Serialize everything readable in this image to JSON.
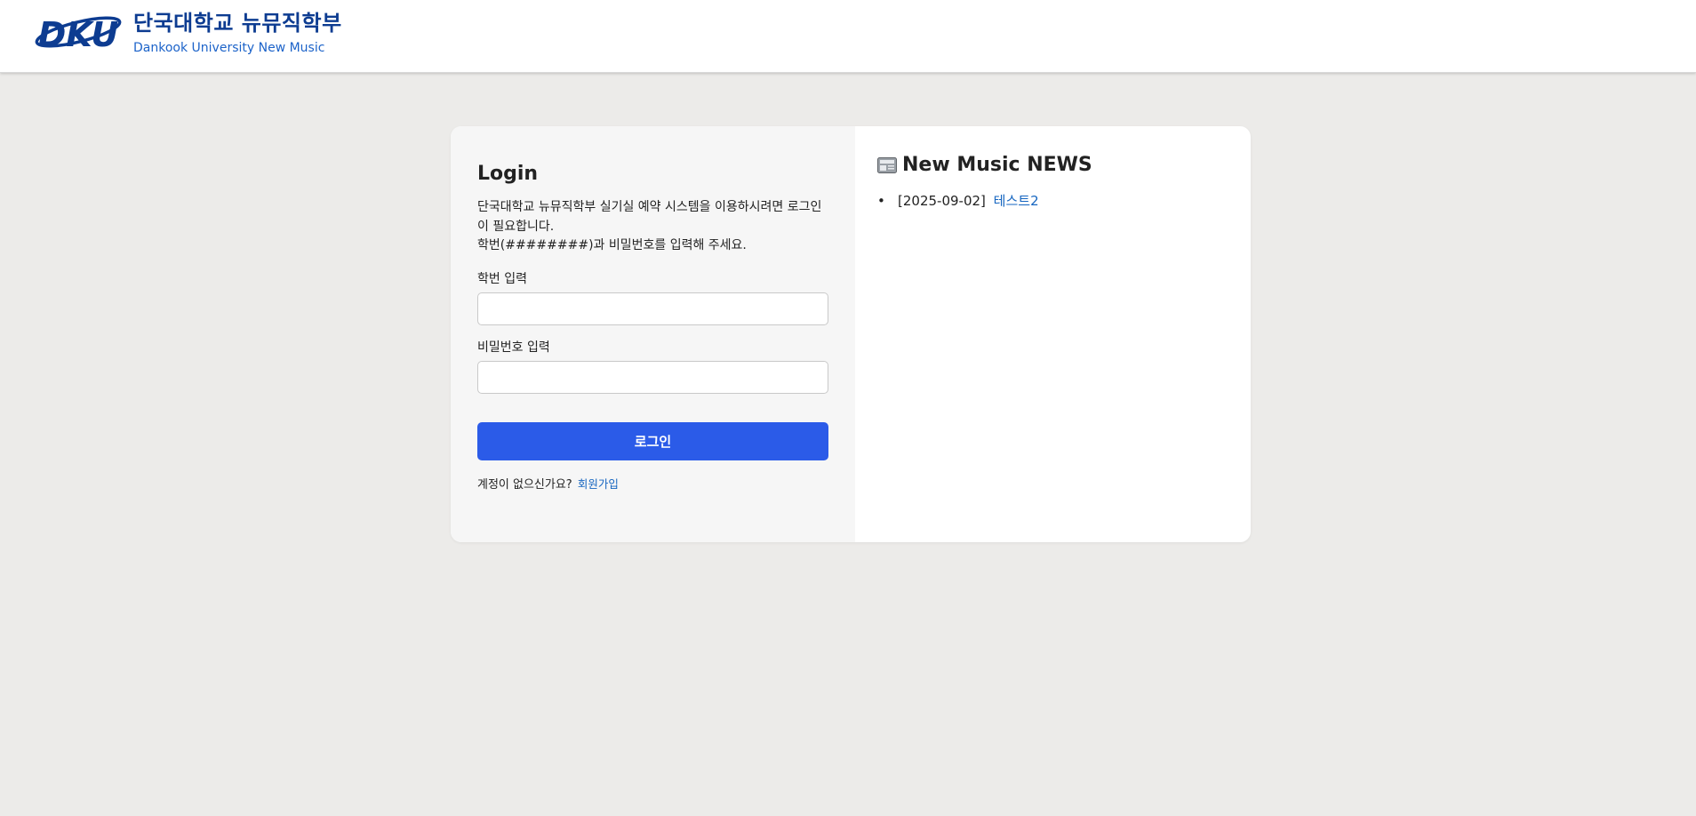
{
  "header": {
    "logo_text": "DKU",
    "title_ko": "단국대학교 뉴뮤직학부",
    "title_en": "Dankook University New Music",
    "brand_color": "#0d3c91",
    "accent_color": "#1c63c9"
  },
  "login": {
    "title": "Login",
    "description_line1": "단국대학교 뉴뮤직학부 실기실 예약 시스템을 이용하시려면 로그인이 필요합니다.",
    "description_line2": "학번(########)과 비밀번호를 입력해 주세요.",
    "student_id_label": "학번 입력",
    "student_id_value": "",
    "password_label": "비밀번호 입력",
    "password_value": "",
    "submit_label": "로그인",
    "signup_prompt": "계정이 없으신가요?",
    "signup_link": "회원가입",
    "button_color": "#2b5be8"
  },
  "news": {
    "icon": "newspaper-icon",
    "title": "New Music NEWS",
    "items": [
      {
        "date": "[2025-09-02]",
        "title": "테스트2"
      }
    ]
  }
}
